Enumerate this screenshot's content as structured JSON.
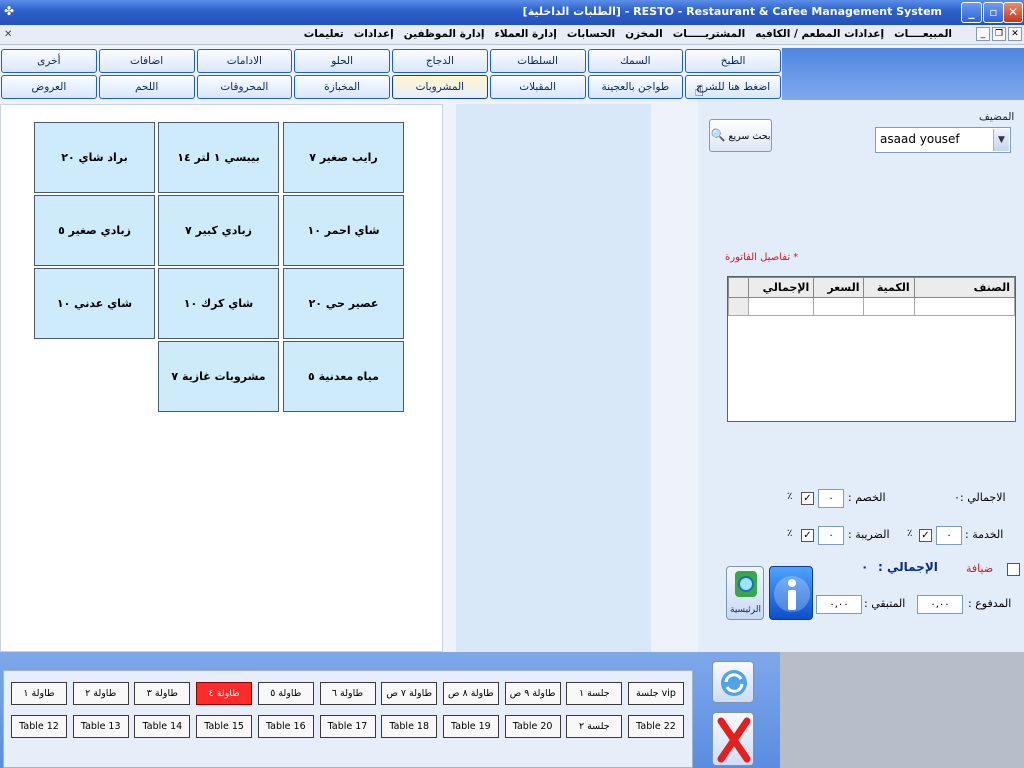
{
  "window": {
    "title": "[الطلبات الداخلية] - RESTO - Restaurant & Cafee Management System"
  },
  "menubar": {
    "items": [
      "المبيعــــات",
      "إعدادات المطعم / الكافيه",
      "المشتريـــــات",
      "المخزن",
      "الحسابات",
      "إدارة العملاء",
      "إدارة الموظفين",
      "إعدادات",
      "تعليمات"
    ]
  },
  "category_tabs": {
    "row1": [
      "أخرى",
      "اضافات",
      "الادامات",
      "الحلو",
      "الدجاج",
      "السلطات",
      "السمك",
      "الطبخ"
    ],
    "row2": [
      "العروض",
      "اللحم",
      "المحروقات",
      "المخبازة",
      "المشروبات",
      "المقبلات",
      "طواجن بالعجينة",
      "اضغط هنا للشرح"
    ],
    "active": "المشروبات"
  },
  "items": [
    "رايب صغير ٧",
    "بيبسي ١ لتر ١٤",
    "براد شاي ٢٠",
    "شاي احمر ١٠",
    "زبادي كبير ٧",
    "زبادي صغير ٥",
    "عصير حي ٢٠",
    "شاي كرك ١٠",
    "شاي عدني ١٠",
    "مياه معدنية ٥",
    "مشروبات غازية ٧"
  ],
  "right_panel": {
    "host_label": "المضيف",
    "host_value": "asaad yousef",
    "quick_search": "بحث سريع",
    "invoice_label": "* تفاصيل الفاتورة",
    "invoice_columns": [
      "الصنف",
      "الكمية",
      "السعر",
      "الإجمالي"
    ],
    "total_label": "الاجمالي :",
    "total_value": "٠",
    "discount_label": "الخصم :",
    "discount_value": "٠",
    "service_label": "الخدمة :",
    "service_value": "٠",
    "tax_label": "الضريبة :",
    "tax_value": "٠",
    "percent": "٪",
    "hospitality_label": "ضيافة",
    "grand_total_label": "الإجمالي :",
    "grand_total_value": "٠",
    "paid_label": "المدفوع :",
    "paid_value": "٠,٠٠",
    "remaining_label": "المتبقي :",
    "remaining_value": "٠,٠٠",
    "home_label": "الرئيسية"
  },
  "tables": {
    "row1": [
      "طاولة ١",
      "طاولة ٢",
      "طاولة ٣",
      "طاولة ٤",
      "طاولة ٥",
      "طاولة ٦",
      "طاولة ٧ ص",
      "طاولة ٨ ص",
      "طاولة ٩ ص",
      "جلسة ١",
      "vip جلسة"
    ],
    "row2": [
      "Table 12",
      "Table 13",
      "Table 14",
      "Table 15",
      "Table 16",
      "Table 17",
      "Table 18",
      "Table 19",
      "Table 20",
      "جلسة ٢",
      "Table 22"
    ],
    "busy": "طاولة ٤"
  },
  "colors": {
    "item_bg": "#cdebfb",
    "busy_table": "#ff2a2a",
    "title_bar": "#2d5fc9"
  }
}
